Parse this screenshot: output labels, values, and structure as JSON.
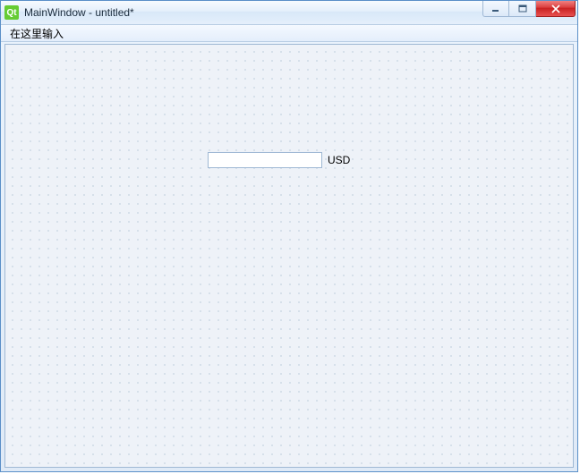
{
  "window": {
    "title": "MainWindow - untitled*",
    "app_icon_text": "Qt"
  },
  "menubar": {
    "type_here": "在这里输入"
  },
  "form": {
    "amount_value": "",
    "currency_label": "USD"
  },
  "controls": {
    "minimize_name": "minimize",
    "maximize_name": "maximize",
    "close_name": "close"
  }
}
